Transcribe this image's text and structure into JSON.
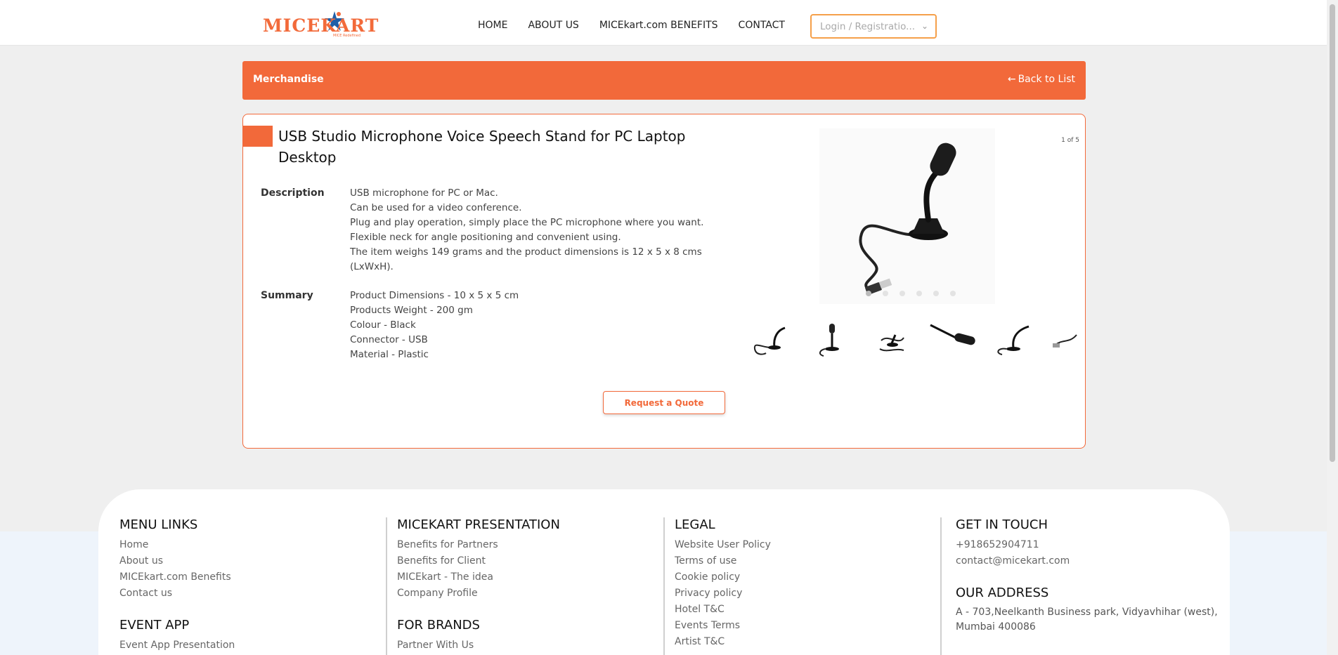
{
  "header": {
    "logo_text": "MICEKART",
    "logo_tagline": "MICE Redefined",
    "nav": [
      "HOME",
      "ABOUT US",
      "MICEkart.com BENEFITS",
      "CONTACT"
    ],
    "login_placeholder": "Login / Registratio..."
  },
  "banner": {
    "title": "Merchandise",
    "back_label": "Back to List"
  },
  "product": {
    "title": "USB Studio Microphone Voice Speech Stand for PC Laptop Desktop",
    "description_label": "Description",
    "description_lines": [
      "USB microphone for PC or Mac.",
      "Can be used  for a video conference.",
      "Plug and play operation, simply place the PC microphone where you want.",
      "Flexible neck for angle positioning and convenient using.",
      "The item weighs 149 grams and the product dimensions is 12 x 5 x 8 cms",
      "(LxWxH)."
    ],
    "summary_label": "Summary",
    "summary_lines": [
      "Product Dimensions - 10 x 5 x 5 cm",
      "Products Weight - 200 gm",
      "Colour - Black",
      "Connector - USB",
      "Material - Plastic"
    ],
    "quote_button": "Request a Quote",
    "image_counter": "1 of 5"
  },
  "footer": {
    "menu_links": {
      "heading": "MENU LINKS",
      "items": [
        "Home",
        "About us",
        "MICEkart.com Benefits",
        "Contact us"
      ]
    },
    "event_app": {
      "heading": "EVENT APP",
      "items": [
        "Event App Presentation"
      ]
    },
    "presentation": {
      "heading": "MICEKART PRESENTATION",
      "items": [
        "Benefits for Partners",
        "Benefits for Client",
        "MICEkart - The idea",
        "Company Profile"
      ]
    },
    "brands": {
      "heading": "FOR BRANDS",
      "items": [
        "Partner With Us"
      ]
    },
    "legal": {
      "heading": "LEGAL",
      "items": [
        "Website User Policy",
        "Terms of use",
        "Cookie policy",
        "Privacy policy",
        "Hotel T&C",
        "Events Terms",
        "Artist T&C"
      ]
    },
    "contact": {
      "heading": "GET IN TOUCH",
      "phone": "+918652904711",
      "email": "contact@micekart.com"
    },
    "address": {
      "heading": "OUR ADDRESS",
      "text": "A - 703,Neelkanth Business park, Vidyavhihar (west), Mumbai 400086"
    }
  },
  "colors": {
    "accent": "#f2693a",
    "login_border": "#f5a04a",
    "footer_bg": "#eef4fb"
  }
}
